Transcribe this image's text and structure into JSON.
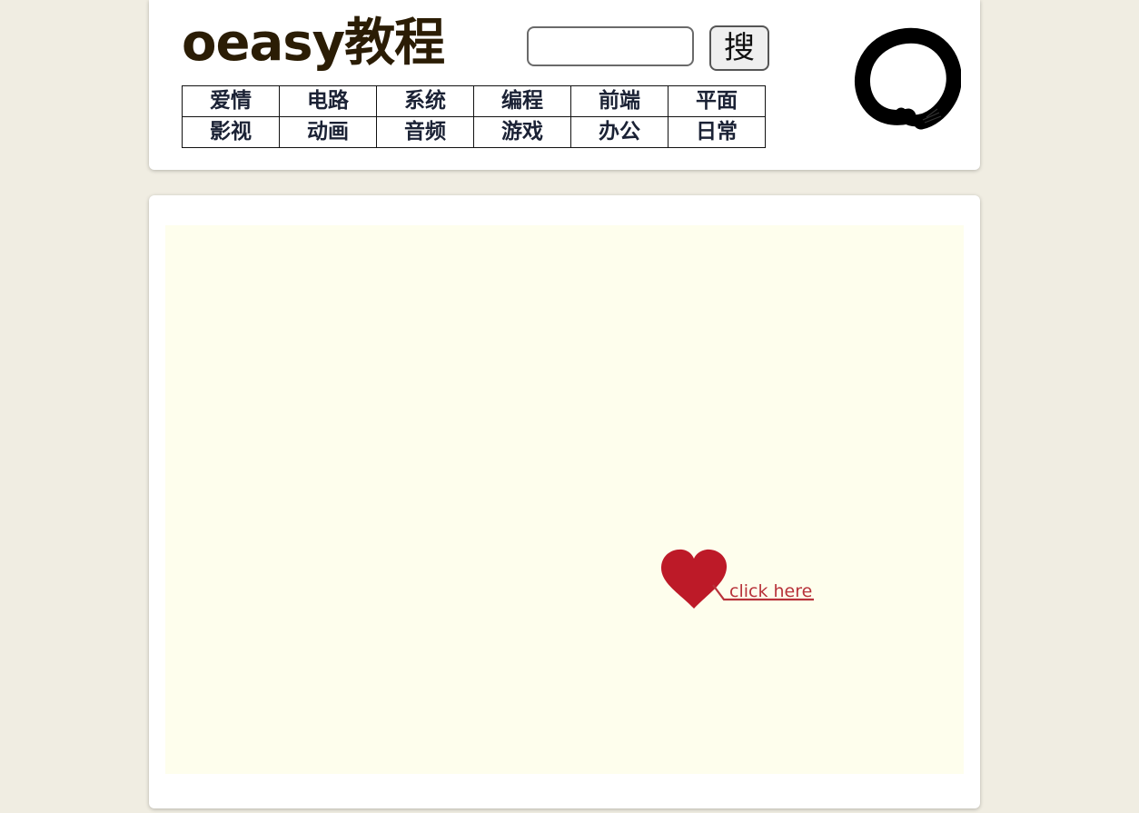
{
  "header": {
    "title": "oeasy教程",
    "search": {
      "value": "",
      "placeholder": "",
      "button_label": "搜"
    },
    "nav": [
      [
        "爱情",
        "电路",
        "系统",
        "编程",
        "前端",
        "平面"
      ],
      [
        "影视",
        "动画",
        "音频",
        "游戏",
        "办公",
        "日常"
      ]
    ],
    "logo_icon": "enso-circle-icon"
  },
  "main": {
    "link": {
      "icon": "heart-icon",
      "label": "click here"
    }
  },
  "colors": {
    "page_bg": "#f0ede2",
    "card_bg": "#ffffff",
    "canvas_bg": "#fefeed",
    "title": "#2b1d05",
    "nav_text": "#1b2235",
    "heart": "#bd1a28",
    "link_text": "#b8333a"
  }
}
